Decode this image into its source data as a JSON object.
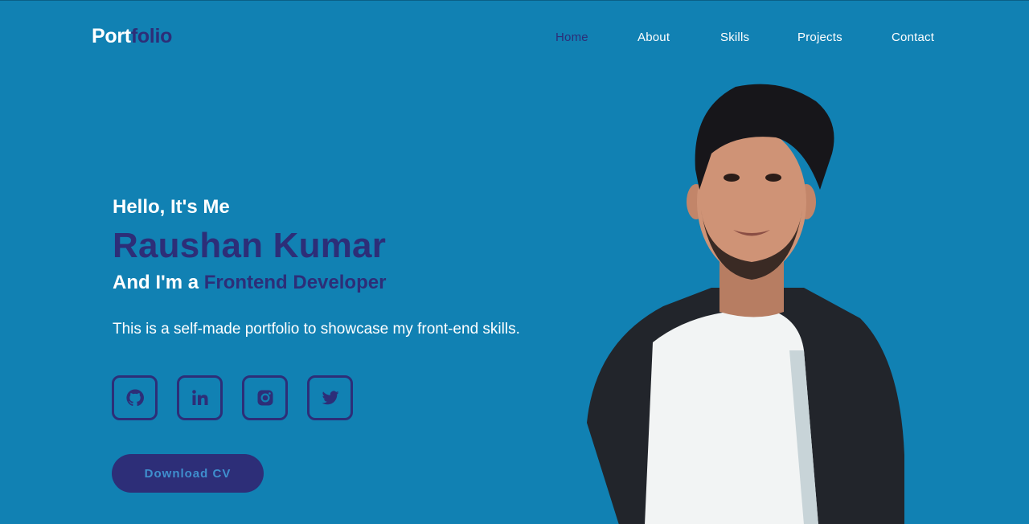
{
  "brand": {
    "part1": "Port",
    "part2": "folio"
  },
  "nav": {
    "items": [
      {
        "label": "Home",
        "active": true
      },
      {
        "label": "About",
        "active": false
      },
      {
        "label": "Skills",
        "active": false
      },
      {
        "label": "Projects",
        "active": false
      },
      {
        "label": "Contact",
        "active": false
      }
    ]
  },
  "hero": {
    "greeting": "Hello, It's Me",
    "name": "Raushan Kumar",
    "role_prefix": "And I'm a ",
    "role": "Frontend Developer",
    "description": "This is a self-made portfolio to showcase my front-end skills.",
    "socials": [
      "github-icon",
      "linkedin-icon",
      "instagram-icon",
      "twitter-icon"
    ],
    "cv_button": "Download CV"
  },
  "colors": {
    "background": "#1181b3",
    "accent": "#2d2e78",
    "text": "#ffffff",
    "button_text": "#3f8fce"
  }
}
